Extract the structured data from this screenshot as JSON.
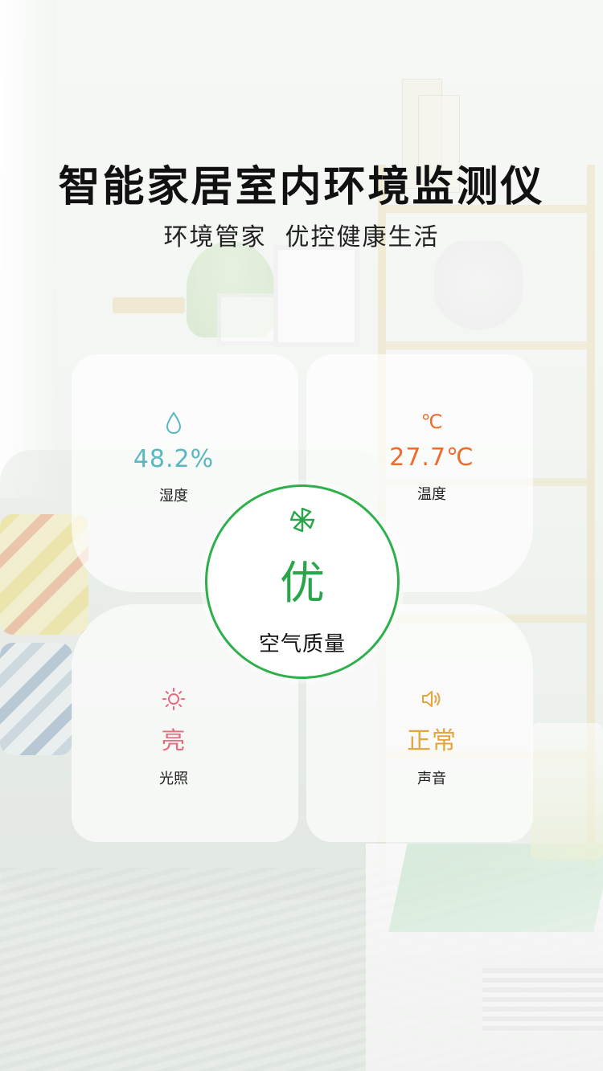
{
  "header": {
    "title": "智能家居室内环境监测仪",
    "subtitle": "环境管家  优控健康生活"
  },
  "metrics": {
    "humidity": {
      "icon": "water-drop-icon",
      "value": "48.2%",
      "label": "湿度",
      "color": "#59b7bf"
    },
    "temperature": {
      "icon_text": "℃",
      "value": "27.7℃",
      "label": "温度",
      "color": "#ef6a2e"
    },
    "light": {
      "icon": "sun-icon",
      "value": "亮",
      "label": "光照",
      "color": "#e86a80"
    },
    "sound": {
      "icon": "speaker-icon",
      "value": "正常",
      "label": "声音",
      "color": "#e6a53a"
    }
  },
  "air_quality": {
    "icon": "fan-icon",
    "value": "优",
    "label": "空气质量",
    "color": "#2aa64a"
  }
}
